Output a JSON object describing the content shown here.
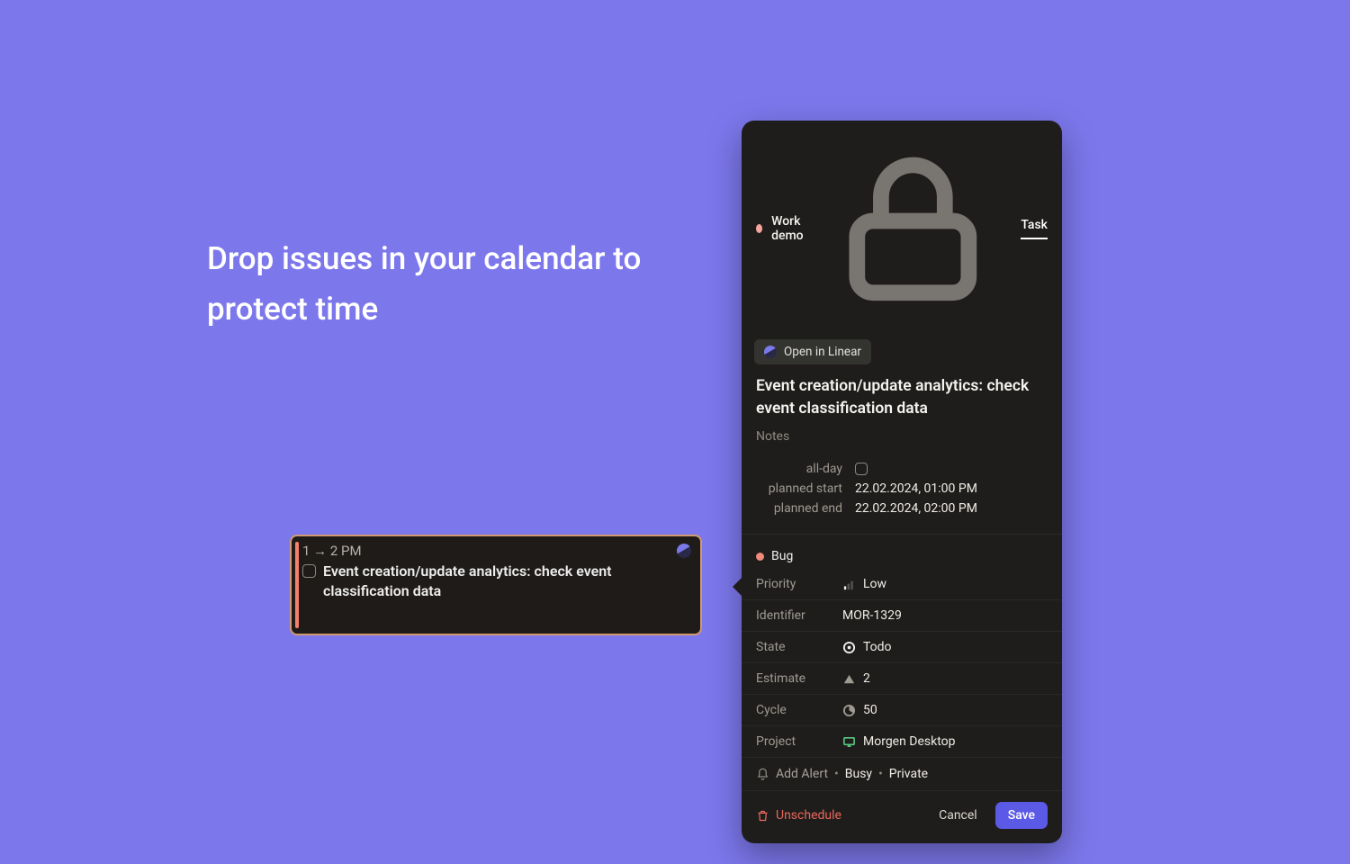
{
  "headline": "Drop issues in your calendar to protect time",
  "eventCard": {
    "timeRange": "1 → 2 PM",
    "title": "Event creation/update analytics: check event classification data"
  },
  "panel": {
    "accountName": "Work demo",
    "tabLabel": "Task",
    "openInLinear": "Open in Linear",
    "title": "Event creation/update analytics: check event classification data",
    "notesPlaceholder": "Notes",
    "fields": {
      "allDayLabel": "all-day",
      "plannedStartLabel": "planned start",
      "plannedStartValue": "22.02.2024, 01:00 PM",
      "plannedEndLabel": "planned end",
      "plannedEndValue": "22.02.2024, 02:00 PM"
    },
    "tag": "Bug",
    "props": {
      "priorityLabel": "Priority",
      "priorityValue": "Low",
      "identifierLabel": "Identifier",
      "identifierValue": "MOR-1329",
      "stateLabel": "State",
      "stateValue": "Todo",
      "estimateLabel": "Estimate",
      "estimateValue": "2",
      "cycleLabel": "Cycle",
      "cycleValue": "50",
      "projectLabel": "Project",
      "projectValue": "Morgen Desktop"
    },
    "alert": {
      "addAlert": "Add Alert",
      "busy": "Busy",
      "privacy": "Private"
    },
    "actions": {
      "unschedule": "Unschedule",
      "cancel": "Cancel",
      "save": "Save"
    }
  }
}
